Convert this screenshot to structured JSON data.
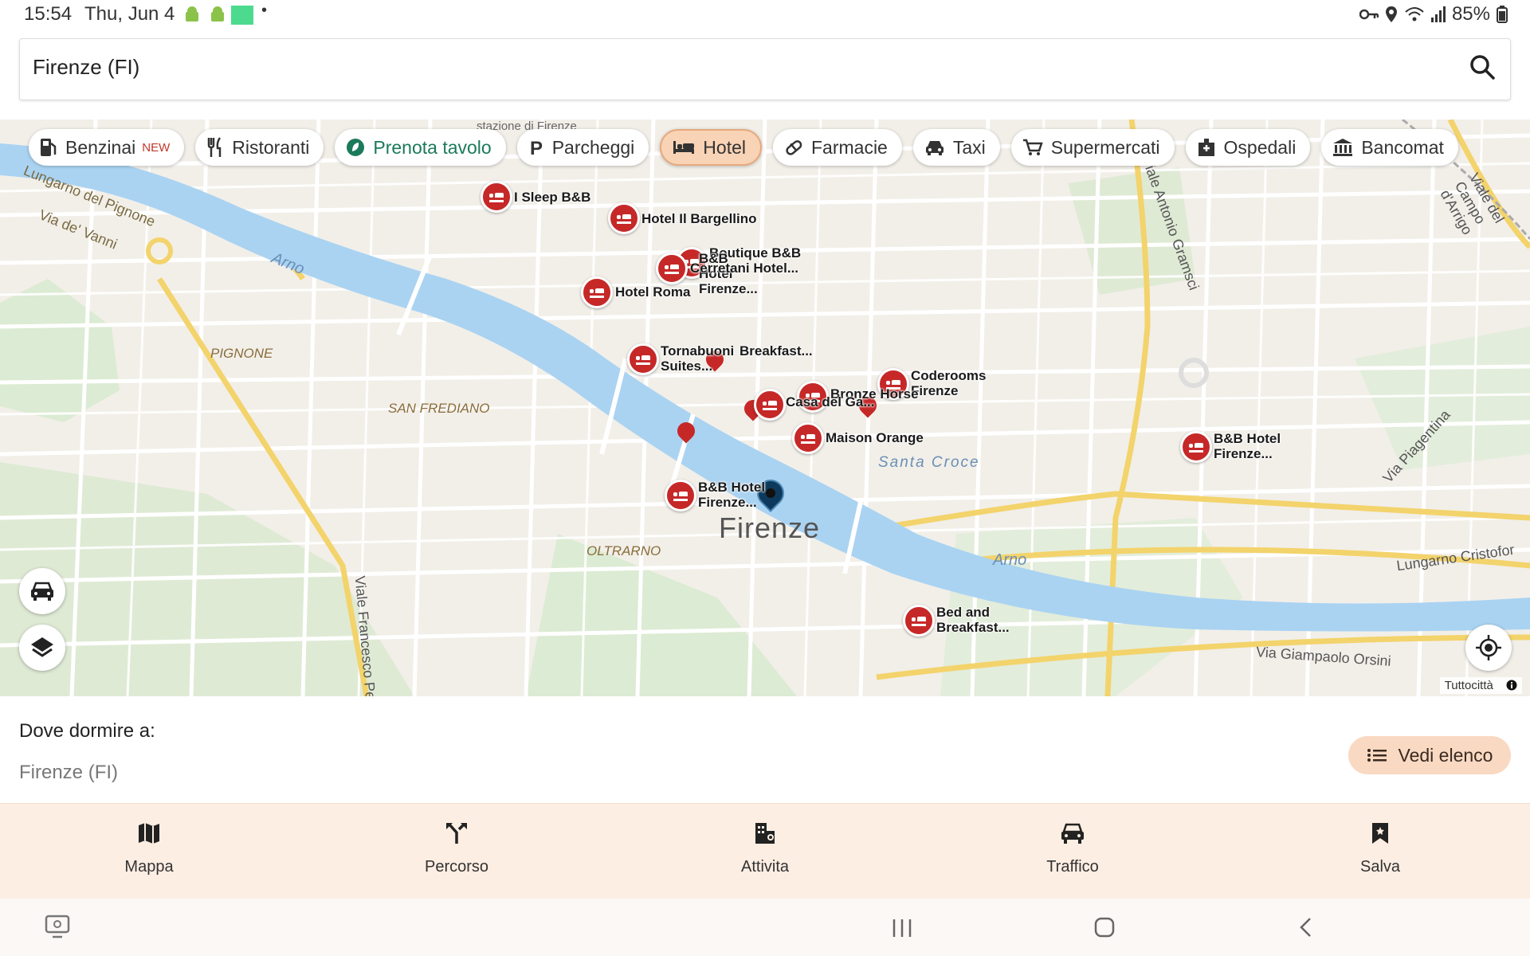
{
  "status_bar": {
    "time": "15:54",
    "date": "Thu, Jun 4",
    "battery": "85%"
  },
  "search": {
    "value": "Firenze (FI)"
  },
  "chips": [
    {
      "label": "Benzinai",
      "badge": "NEW",
      "icon": "fuel-pump-icon"
    },
    {
      "label": "Ristoranti",
      "icon": "fork-knife-icon"
    },
    {
      "label": "Prenota tavolo",
      "icon": "leaf-icon"
    },
    {
      "label": "Parcheggi",
      "icon": "parking-icon"
    },
    {
      "label": "Hotel",
      "icon": "bed-icon",
      "active": true
    },
    {
      "label": "Farmacie",
      "icon": "pill-icon"
    },
    {
      "label": "Taxi",
      "icon": "taxi-icon"
    },
    {
      "label": "Supermercati",
      "icon": "cart-icon"
    },
    {
      "label": "Ospedali",
      "icon": "hospital-icon"
    },
    {
      "label": "Bancomat",
      "icon": "bank-icon"
    }
  ],
  "map": {
    "city_label": "Firenze",
    "area_labels": [
      "PIGNONE",
      "SAN FREDIANO",
      "OLTRARNO",
      "Arno",
      "Arno",
      "Lungarno del Pignone",
      "Via de' Vanni",
      "Viale Francesco Pe",
      "Viale Antonio Gramsci",
      "Via Piagentina",
      "Lungarno Cristofor",
      "Via Giampaolo Orsini",
      "Viale del Campo d'Arrigo",
      "stazione di Firenze",
      "Santa Croce"
    ],
    "hotels": [
      {
        "name": "I Sleep B&B"
      },
      {
        "name": "Hotel Il Bargellino"
      },
      {
        "name": "Boutique B&B"
      },
      {
        "name": "B&B Hotel Firenze..."
      },
      {
        "name": "Cerretani Hotel..."
      },
      {
        "name": "Hotel Roma"
      },
      {
        "name": "Tornabuoni Suites..."
      },
      {
        "name": "Breakfast..."
      },
      {
        "name": "Coderooms Firenze"
      },
      {
        "name": "Bronze Horse"
      },
      {
        "name": "Casa del Ga..."
      },
      {
        "name": "Maison Orange"
      },
      {
        "name": "B&B Hotel Firenze..."
      },
      {
        "name": "B&B Hotel Firenze..."
      },
      {
        "name": "Bed and Breakfast..."
      }
    ],
    "attribution": "Tuttocittà"
  },
  "info": {
    "title": "Dove dormire a:",
    "location": "Firenze (FI)",
    "list_button": "Vedi elenco"
  },
  "bottom_nav": [
    {
      "label": "Mappa",
      "icon": "map-icon"
    },
    {
      "label": "Percorso",
      "icon": "route-icon"
    },
    {
      "label": "Attivita",
      "icon": "buildings-icon"
    },
    {
      "label": "Traffico",
      "icon": "car-traffic-icon"
    },
    {
      "label": "Salva",
      "icon": "bookmark-icon"
    }
  ]
}
